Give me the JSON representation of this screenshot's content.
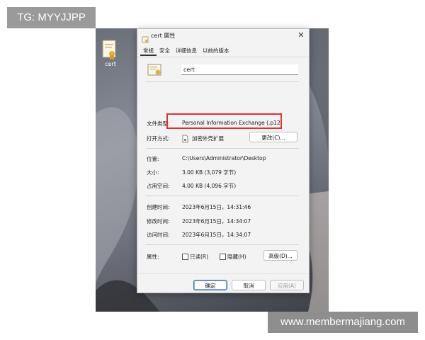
{
  "watermarks": {
    "top_left": "TG: MYYJJPP",
    "bottom_right": "www.membermajiang.com"
  },
  "desktop": {
    "icon_label": "cert"
  },
  "dialog": {
    "title": "cert 属性",
    "tabs": [
      {
        "label": "常规",
        "active": true
      },
      {
        "label": "安全",
        "active": false
      },
      {
        "label": "详细信息",
        "active": false
      },
      {
        "label": "以前的版本",
        "active": false
      }
    ],
    "file_name": "cert",
    "rows": {
      "file_type": {
        "label": "文件类型:",
        "value": "Personal Information Exchange (.p12)"
      },
      "open_with": {
        "label": "打开方式:",
        "value": "加密外壳扩展",
        "button": "更改(C)..."
      },
      "location": {
        "label": "位置:",
        "value": "C:\\Users\\Administrator\\Desktop"
      },
      "size": {
        "label": "大小:",
        "value": "3.00 KB (3,079 字节)"
      },
      "size_on_disk": {
        "label": "占用空间:",
        "value": "4.00 KB (4,096 字节)"
      },
      "created": {
        "label": "创建时间:",
        "value": "2023年6月15日，14:31:46"
      },
      "modified": {
        "label": "修改时间:",
        "value": "2023年6月15日，14:34:07"
      },
      "accessed": {
        "label": "访问时间:",
        "value": "2023年6月15日，14:34:07"
      },
      "attributes": {
        "label": "属性:",
        "readonly": "只读(R)",
        "hidden": "隐藏(H)",
        "advanced_button": "高级(D)..."
      }
    },
    "buttons": {
      "ok": "确定",
      "cancel": "取消",
      "apply": "应用(A)"
    }
  },
  "colors": {
    "highlight_border": "#e03030",
    "dialog_bg": "#f3f3f3"
  }
}
